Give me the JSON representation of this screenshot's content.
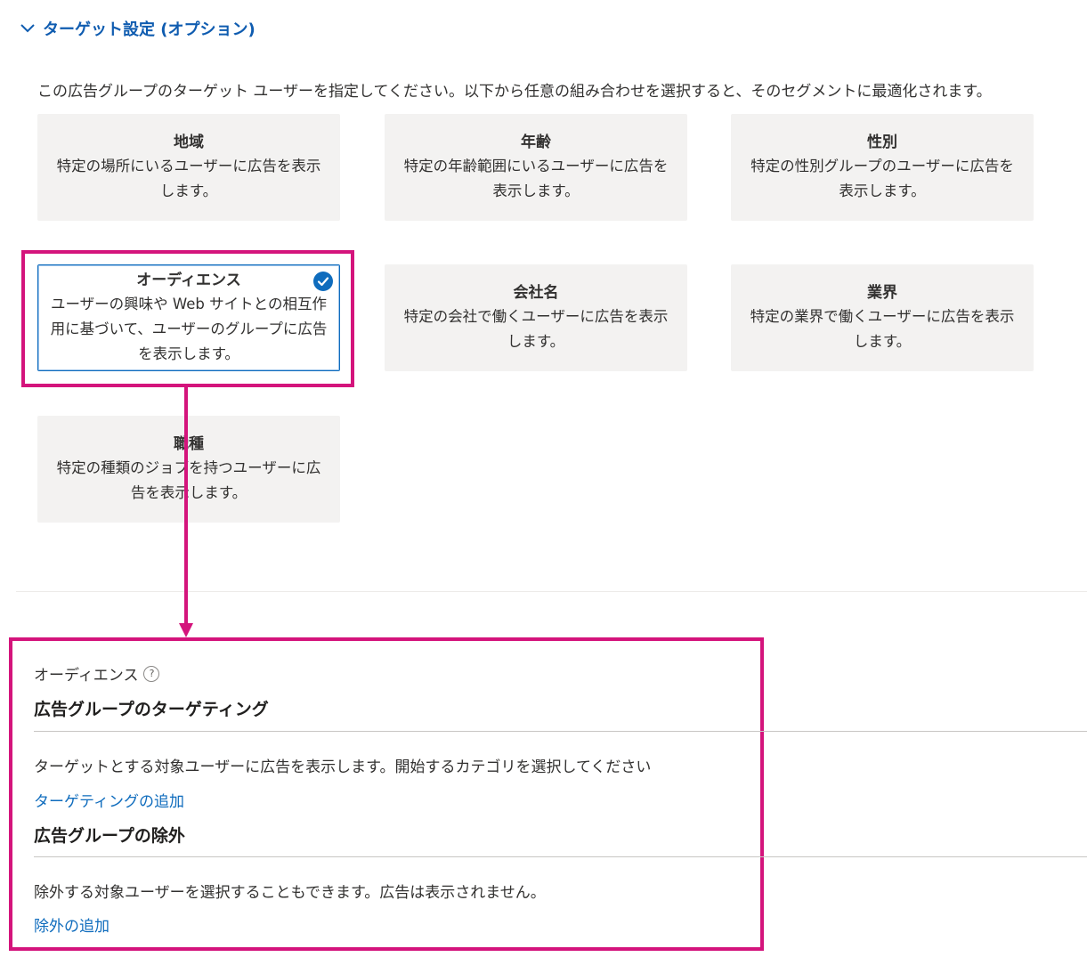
{
  "section": {
    "title": "ターゲット設定 (オプション)",
    "icon": "chevron-down-icon"
  },
  "intro": "この広告グループのターゲット ユーザーを指定してください。以下から任意の組み合わせを選択すると、そのセグメントに最適化されます。",
  "cards": [
    {
      "title": "地域",
      "desc": "特定の場所にいるユーザーに広告を表示します。",
      "selected": false
    },
    {
      "title": "年齢",
      "desc": "特定の年齢範囲にいるユーザーに広告を表示します。",
      "selected": false
    },
    {
      "title": "性別",
      "desc": "特定の性別グループのユーザーに広告を表示します。",
      "selected": false
    },
    {
      "title": "オーディエンス",
      "desc": "ユーザーの興味や Web サイトとの相互作用に基づいて、ユーザーのグループに広告を表示します。",
      "selected": true
    },
    {
      "title": "会社名",
      "desc": "特定の会社で働くユーザーに広告を表示します。",
      "selected": false
    },
    {
      "title": "業界",
      "desc": "特定の業界で働くユーザーに広告を表示します。",
      "selected": false
    },
    {
      "title": "職種",
      "desc": "特定の種類のジョブを持つユーザーに広告を表示します。",
      "selected": false
    }
  ],
  "panel": {
    "label": "オーディエンス",
    "help_icon": "?",
    "targeting_heading": "広告グループのターゲティング",
    "targeting_desc": "ターゲットとする対象ユーザーに広告を表示します。開始するカテゴリを選択してください",
    "targeting_link": "ターゲティングの追加",
    "exclusion_heading": "広告グループの除外",
    "exclusion_desc": "除外する対象ユーザーを選択することもできます。広告は表示されません。",
    "exclusion_link": "除外の追加"
  },
  "colors": {
    "accent": "#0f6cbd",
    "annotation": "#d4147c",
    "card_bg": "#f3f2f1"
  }
}
